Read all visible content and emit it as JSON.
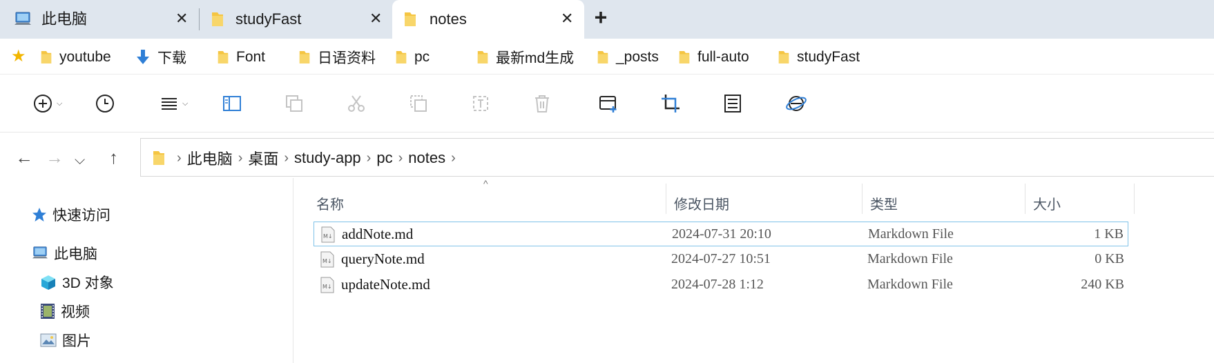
{
  "tabs": [
    {
      "title": "此电脑",
      "icon": "computer-icon"
    },
    {
      "title": "studyFast",
      "icon": "folder-icon"
    },
    {
      "title": "notes",
      "icon": "folder-icon",
      "active": true
    }
  ],
  "new_tab_label": "+",
  "close_glyph": "✕",
  "bookmarks": [
    {
      "label": "youtube",
      "icon": "folder-icon"
    },
    {
      "label": "下载",
      "icon": "download-icon"
    },
    {
      "label": "Font",
      "icon": "folder-icon"
    },
    {
      "label": "日语资料",
      "icon": "folder-icon"
    },
    {
      "label": "pc",
      "icon": "folder-icon"
    },
    {
      "label": "最新md生成",
      "icon": "folder-icon"
    },
    {
      "label": "_posts",
      "icon": "folder-icon"
    },
    {
      "label": "full-auto",
      "icon": "folder-icon"
    },
    {
      "label": "studyFast",
      "icon": "folder-icon"
    }
  ],
  "breadcrumb": [
    "此电脑",
    "桌面",
    "study-app",
    "pc",
    "notes"
  ],
  "nav_pane": {
    "quick_access": "快速访问",
    "this_pc": "此电脑",
    "objects_3d": "3D 对象",
    "videos": "视频",
    "pictures": "图片"
  },
  "columns": {
    "name": "名称",
    "modified": "修改日期",
    "type": "类型",
    "size": "大小"
  },
  "files": [
    {
      "name": "addNote.md",
      "modified": "2024-07-31 20:10",
      "type": "Markdown File",
      "size": "1 KB",
      "selected": true
    },
    {
      "name": "queryNote.md",
      "modified": "2024-07-27 10:51",
      "type": "Markdown File",
      "size": "0 KB"
    },
    {
      "name": "updateNote.md",
      "modified": "2024-07-28 1:12",
      "type": "Markdown File",
      "size": "240 KB"
    }
  ],
  "colors": {
    "tabbar_bg": "#dfe6ee",
    "folder": "#f5c542",
    "selection_border": "#7fc2e8",
    "star": "#f2b600",
    "download": "#2f7fd6"
  }
}
